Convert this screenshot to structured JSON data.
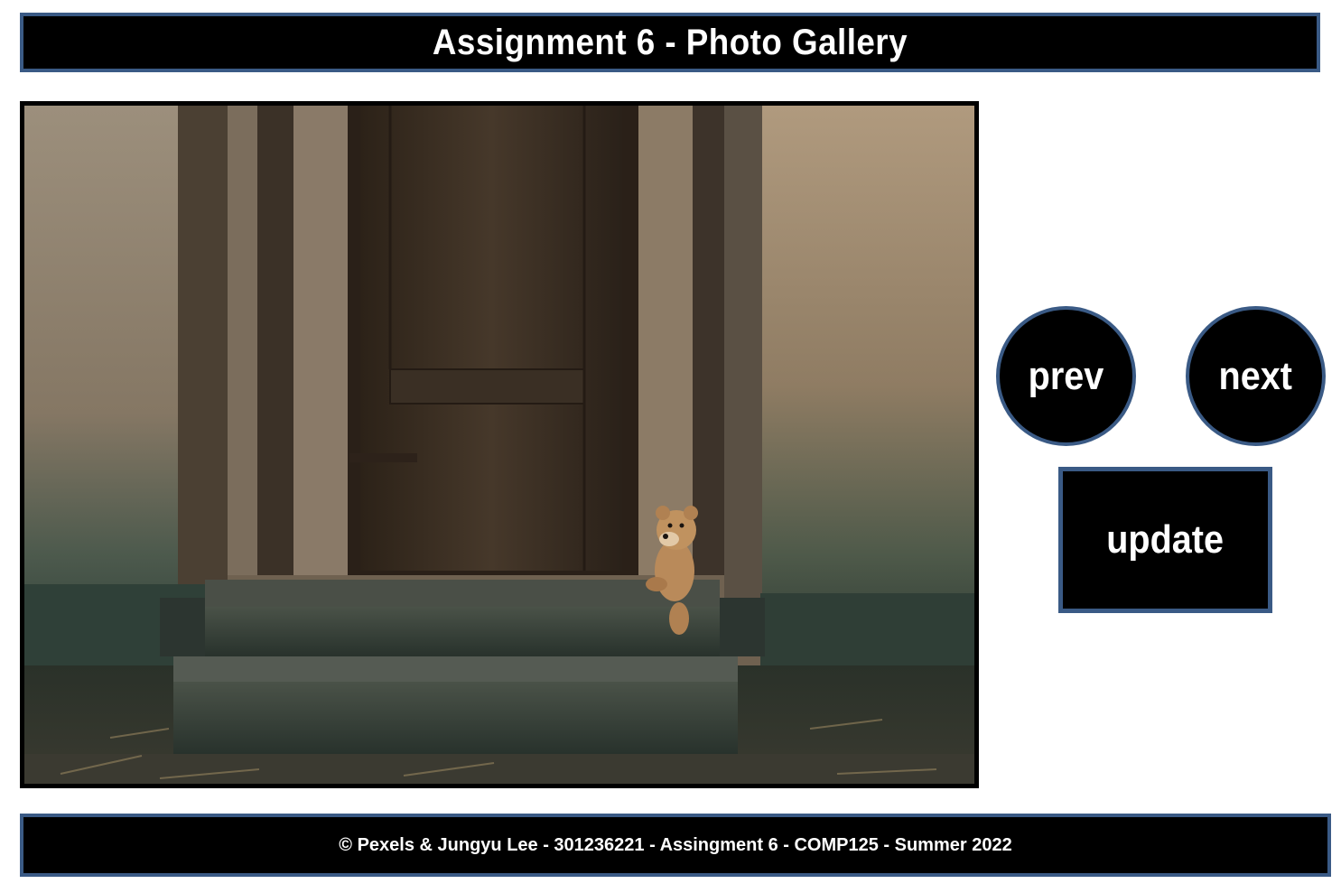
{
  "header": {
    "title": "Assignment 6 - Photo Gallery"
  },
  "gallery": {
    "image_alt": "Teddy bear sitting on the wooden steps of an old weathered door"
  },
  "controls": {
    "prev_label": "prev",
    "next_label": "next",
    "update_label": "update"
  },
  "footer": {
    "text": "© Pexels & Jungyu Lee - 301236221 - Assingment 6 - COMP125 - Summer 2022"
  },
  "colors": {
    "accent_border": "#3a5a85",
    "panel_background": "#000000",
    "text": "#ffffff"
  }
}
